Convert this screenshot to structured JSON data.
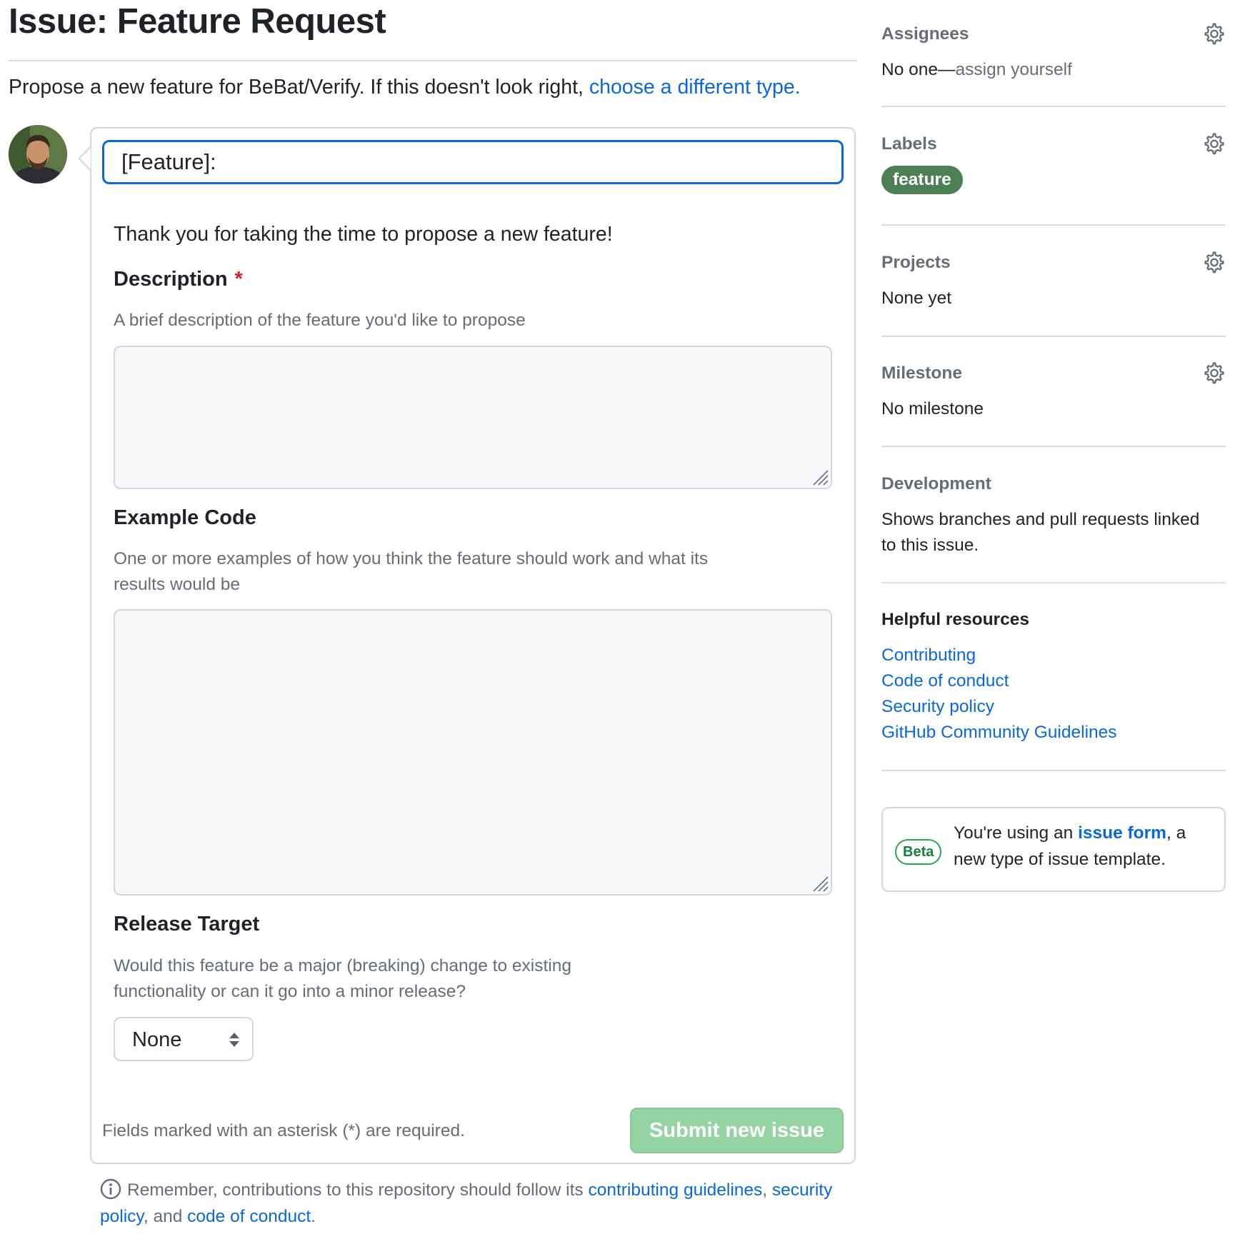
{
  "header": {
    "title": "Issue: Feature Request",
    "subtitle_prefix": "Propose a new feature for BeBat/Verify. If this doesn't look right, ",
    "subtitle_link": "choose a different type."
  },
  "form": {
    "title_value": "[Feature]: ",
    "intro": "Thank you for taking the time to propose a new feature!",
    "description": {
      "label": "Description",
      "required_mark": "*",
      "help": "A brief description of the feature you'd like to propose"
    },
    "example_code": {
      "label": "Example Code",
      "help": "One or more examples of how you think the feature should work and what its results would be"
    },
    "release_target": {
      "label": "Release Target",
      "help": "Would this feature be a major (breaking) change to existing functionality or can it go into a minor release?",
      "selected": "None"
    },
    "required_note": "Fields marked with an asterisk (*) are required.",
    "submit_label": "Submit new issue"
  },
  "footer": {
    "prefix": "Remember, contributions to this repository should follow its ",
    "link_guidelines": "contributing guidelines",
    "sep1": ", ",
    "link_security": "security policy",
    "sep2": ", and ",
    "link_conduct": "code of conduct",
    "suffix": "."
  },
  "sidebar": {
    "assignees": {
      "title": "Assignees",
      "value_prefix": "No one—",
      "value_link": "assign yourself"
    },
    "labels": {
      "title": "Labels",
      "label": "feature",
      "label_color": "#4c7f53"
    },
    "projects": {
      "title": "Projects",
      "value": "None yet"
    },
    "milestone": {
      "title": "Milestone",
      "value": "No milestone"
    },
    "development": {
      "title": "Development",
      "value": "Shows branches and pull requests linked to this issue."
    },
    "resources": {
      "title": "Helpful resources",
      "links": [
        "Contributing",
        "Code of conduct",
        "Security policy",
        "GitHub Community Guidelines"
      ]
    },
    "beta": {
      "badge": "Beta",
      "text_prefix": "You're using an ",
      "text_link": "issue form",
      "text_suffix": ", a new type of issue template."
    }
  },
  "colors": {
    "accent": "#0969da",
    "submit_disabled": "#94d3a2",
    "required": "#cf222e"
  }
}
